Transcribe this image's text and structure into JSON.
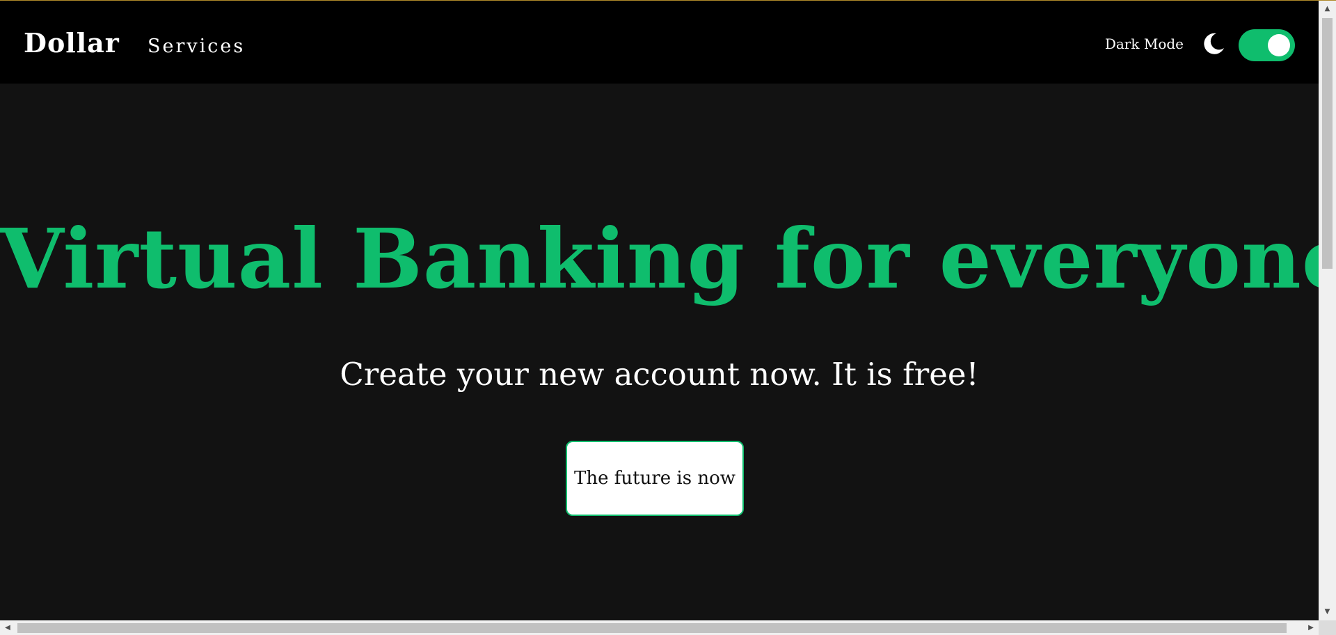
{
  "navbar": {
    "brand": "Dollar",
    "links": [
      {
        "label": "Services"
      }
    ],
    "dark_mode_label": "Dark Mode",
    "dark_mode_icon": "moon-icon",
    "dark_mode_enabled": true
  },
  "hero": {
    "title": "Virtual Banking for everyone",
    "subtitle": "Create your new account now. It is free!",
    "cta_label": "The future is now"
  },
  "colors": {
    "accent": "#0fbd6d",
    "background": "#121212",
    "navbar": "#000000",
    "text": "#ffffff"
  },
  "scrollbars": {
    "up_arrow": "▲",
    "down_arrow": "▼",
    "left_arrow": "◀",
    "right_arrow": "▶"
  }
}
